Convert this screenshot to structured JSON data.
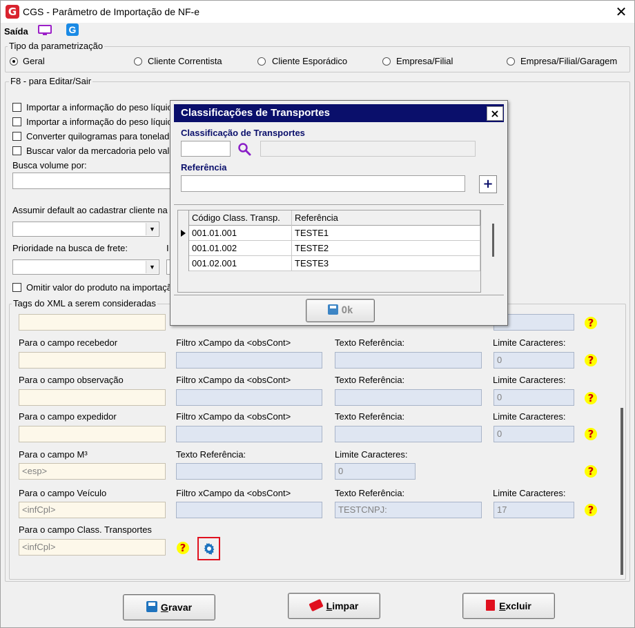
{
  "window": {
    "title": "CGS - Parâmetro de Importação de NF-e",
    "logo_letter": "G"
  },
  "toolbar": {
    "exit_label": "Saída"
  },
  "param_type": {
    "legend": "Tipo da parametrização",
    "options": [
      "Geral",
      "Cliente Correntista",
      "Cliente Esporádico",
      "Empresa/Filial",
      "Empresa/Filial/Garagem"
    ],
    "selected": "Geral"
  },
  "edit_group": {
    "legend": "F8 - para Editar/Sair",
    "checkboxes": [
      "Importar a informação do peso líquic",
      "Importar a informação do peso líquic",
      "Converter quilogramas para tonelad",
      "Buscar valor da mercadoria pelo val"
    ],
    "busca_volume_label": "Busca volume por:",
    "assumir_label": "Assumir default ao cadastrar cliente na",
    "prioridade_label": "Prioridade na busca de frete:",
    "omitir_label": "Omitir valor do produto na importaçã"
  },
  "tags": {
    "legend": "Tags do XML a serem consideradas",
    "rows": [
      {
        "label": "",
        "value": "",
        "c2_label": "",
        "c3_label": "",
        "c4_label": "",
        "c4_value": ""
      },
      {
        "label": "Para o campo recebedor",
        "value": "",
        "c2_label": "Filtro xCampo da <obsCont>",
        "c2_value": "",
        "c3_label": "Texto Referência:",
        "c3_value": "",
        "c4_label": "Limite Caracteres:",
        "c4_value": "0"
      },
      {
        "label": "Para o campo observação",
        "value": "",
        "c2_label": "Filtro xCampo da <obsCont>",
        "c2_value": "",
        "c3_label": "Texto Referência:",
        "c3_value": "",
        "c4_label": "Limite Caracteres:",
        "c4_value": "0"
      },
      {
        "label": "Para o campo expedidor",
        "value": "",
        "c2_label": "Filtro xCampo da <obsCont>",
        "c2_value": "",
        "c3_label": "Texto Referência:",
        "c3_value": "",
        "c4_label": "Limite Caracteres:",
        "c4_value": "0"
      },
      {
        "label": "Para o campo M³",
        "value": "<esp>",
        "c2_label": "Texto Referência:",
        "c2_value": "",
        "c3_label": "Limite Caracteres:",
        "c3_value": "0"
      },
      {
        "label": "Para o campo Veículo",
        "value": "<infCpl>",
        "c2_label": "Filtro xCampo da <obsCont>",
        "c2_value": "",
        "c3_label": "Texto Referência:",
        "c3_value": "TESTCNPJ:",
        "c4_label": "Limite Caracteres:",
        "c4_value": "17"
      },
      {
        "label": "Para o campo Class. Transportes",
        "value": "<infCpl>"
      }
    ],
    "help_glyph": "?"
  },
  "buttons": {
    "gravar": {
      "u": "G",
      "rest": "ravar"
    },
    "limpar": {
      "u": "L",
      "rest": "impar"
    },
    "excluir": {
      "u": "E",
      "rest": "xcluir"
    }
  },
  "dialog": {
    "title": "Classificações de Transportes",
    "close": "×",
    "class_label": "Classificação de Transportes",
    "class_code": "",
    "class_desc": "",
    "ref_label": "Referência",
    "ref_value": "",
    "add_glyph": "+",
    "grid": {
      "columns": [
        "Código Class. Transp.",
        "Referência"
      ],
      "rows": [
        {
          "code": "001.01.001",
          "ref": "TESTE1"
        },
        {
          "code": "001.01.002",
          "ref": "TESTE2"
        },
        {
          "code": "001.02.001",
          "ref": "TESTE3"
        }
      ]
    },
    "ok_label": "Ok"
  }
}
